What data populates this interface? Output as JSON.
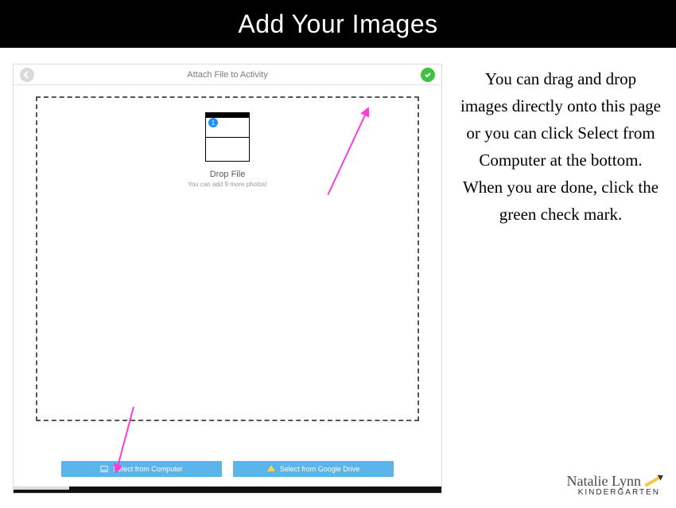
{
  "title": "Add Your Images",
  "screenshot": {
    "header_title": "Attach File to Activity",
    "drop_label": "Drop File",
    "drop_sublabel": "You can add 9 more photos!",
    "thumb_badge": "1",
    "btn_computer": "Select from Computer",
    "btn_drive": "Select from Google Drive"
  },
  "instructions": "You can drag and drop images directly onto this page or you can click Select from Computer at the bottom. When you are done, click the green check mark.",
  "footer": {
    "name": "Natalie Lynn",
    "sub": "KINDERGARTEN"
  }
}
